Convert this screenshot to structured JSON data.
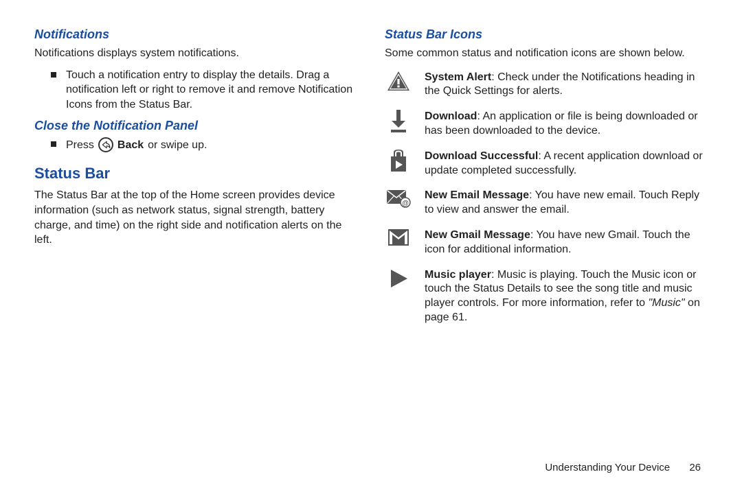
{
  "left": {
    "notif_heading": "Notifications",
    "notif_intro": "Notifications displays system notifications.",
    "notif_bullet": "Touch a notification entry to display the details. Drag a notification left or right to remove it and remove Notification Icons from the Status Bar.",
    "close_heading": "Close the Notification Panel",
    "close_press": "Press",
    "close_back": "Back",
    "close_rest": "or swipe up.",
    "status_heading": "Status Bar",
    "status_body": "The Status Bar at the top of the Home screen provides device information (such as network status, signal strength, battery charge, and time) on the right side and notification alerts on the left."
  },
  "right": {
    "icons_heading": "Status Bar Icons",
    "icons_intro": "Some common status and notification icons are shown below.",
    "rows": [
      {
        "title": "System Alert",
        "text": ": Check under the Notifications heading in the Quick Settings for alerts."
      },
      {
        "title": "Download",
        "text": ": An application or file is being downloaded or has been downloaded to the device."
      },
      {
        "title": "Download Successful",
        "text": ": A recent application download or update completed successfully."
      },
      {
        "title": "New Email Message",
        "text": ": You have new email. Touch Reply to view and answer the email."
      },
      {
        "title": "New Gmail Message",
        "text": ": You have new Gmail. Touch the icon for additional information."
      },
      {
        "title": "Music player",
        "text_pre": ": Music is playing. Touch the Music icon or touch the Status Details to see the song title and music player controls. For more information, refer to ",
        "ref": "\"Music\"",
        "text_post": " on page 61."
      }
    ]
  },
  "footer": {
    "section": "Understanding Your Device",
    "page": "26"
  }
}
